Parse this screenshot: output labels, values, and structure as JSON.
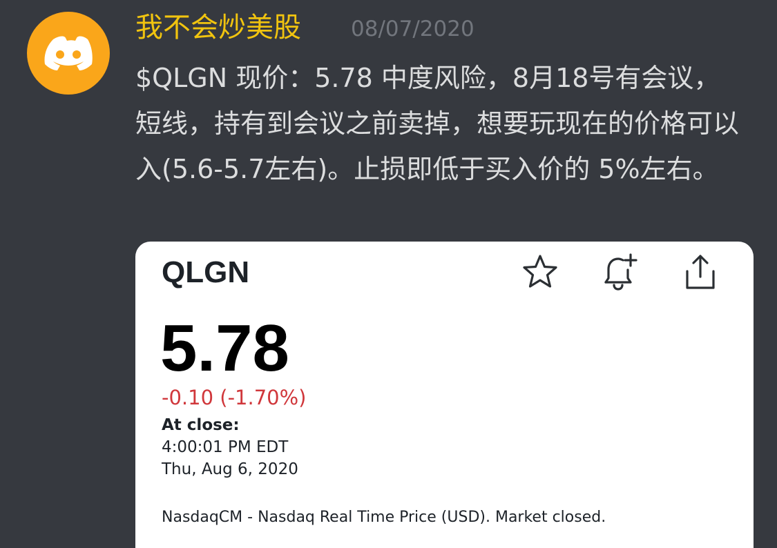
{
  "message": {
    "username": "我不会炒美股",
    "timestamp": "08/07/2020",
    "text": "$QLGN 现价：5.78 中度风险，8月18号有会议，短线，持有到会议之前卖掉，想要玩现在的价格可以入(5.6-5.7左右)。止损即低于买入价的 5%左右。",
    "avatar_icon": "discord-logo-icon"
  },
  "embed": {
    "ticker": "QLGN",
    "price": "5.78",
    "change": "-0.10 (-1.70%)",
    "close_label": "At close:",
    "close_time": "4:00:01 PM EDT",
    "close_date": "Thu, Aug 6, 2020",
    "market_note": "NasdaqCM - Nasdaq Real Time Price (USD). Market closed.",
    "actions": [
      "star-icon",
      "bell-plus-icon",
      "share-icon"
    ]
  },
  "colors": {
    "background": "#36393f",
    "avatar": "#faa61a",
    "username": "#f1c40f",
    "timestamp": "#72767d",
    "message_text": "#dcddde",
    "negative_change": "#d0373b"
  }
}
